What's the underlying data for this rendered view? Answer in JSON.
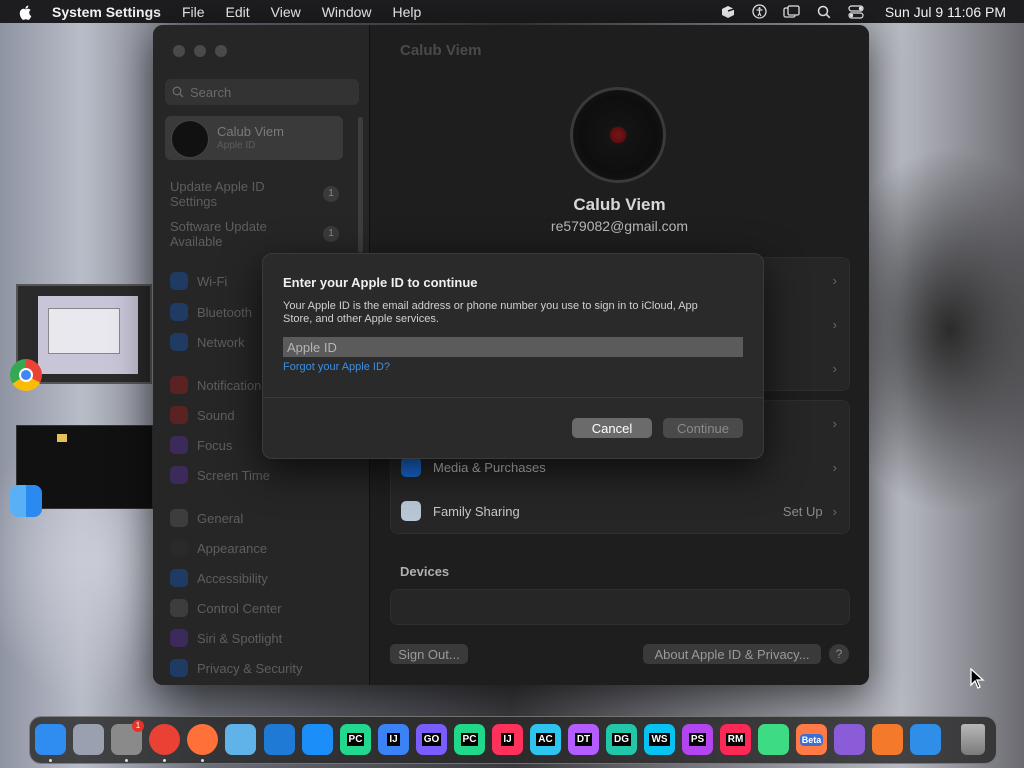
{
  "menubar": {
    "app_name": "System Settings",
    "items": [
      "File",
      "Edit",
      "View",
      "Window",
      "Help"
    ],
    "clock": "Sun Jul 9  11:06 PM"
  },
  "sidebar": {
    "search_placeholder": "Search",
    "account": {
      "name": "Calub Viem",
      "subtitle": "Apple ID"
    },
    "updates": [
      {
        "label": "Update Apple ID Settings",
        "badge": "1"
      },
      {
        "label": "Software Update Available",
        "badge": "1"
      }
    ],
    "items": [
      {
        "label": "Wi-Fi",
        "icon": "wifi-icon"
      },
      {
        "label": "Bluetooth",
        "icon": "bluetooth-icon"
      },
      {
        "label": "Network",
        "icon": "network-icon"
      },
      {
        "label": "Notifications",
        "icon": "notifications-icon"
      },
      {
        "label": "Sound",
        "icon": "sound-icon"
      },
      {
        "label": "Focus",
        "icon": "focus-icon"
      },
      {
        "label": "Screen Time",
        "icon": "screen-time-icon"
      },
      {
        "label": "General",
        "icon": "general-icon"
      },
      {
        "label": "Appearance",
        "icon": "appearance-icon"
      },
      {
        "label": "Accessibility",
        "icon": "accessibility-icon"
      },
      {
        "label": "Control Center",
        "icon": "control-center-icon"
      },
      {
        "label": "Siri & Spotlight",
        "icon": "siri-icon"
      },
      {
        "label": "Privacy & Security",
        "icon": "privacy-icon"
      }
    ]
  },
  "content": {
    "title": "Calub Viem",
    "user_name": "Calub Viem",
    "user_email": "re579082@gmail.com",
    "rows": [
      {
        "label": "Media & Purchases",
        "value": ""
      },
      {
        "label": "Family Sharing",
        "value": "Set Up"
      }
    ],
    "devices_heading": "Devices",
    "sign_out": "Sign Out...",
    "about": "About Apple ID & Privacy...",
    "help": "?"
  },
  "dialog": {
    "title": "Enter your Apple ID to continue",
    "description": "Your Apple ID is the email address or phone number you use to sign in to iCloud, App Store, and other Apple services.",
    "field_placeholder": "Apple ID",
    "field_value": "",
    "forgot": "Forgot your Apple ID?",
    "cancel": "Cancel",
    "continue": "Continue"
  },
  "dock": {
    "apps": [
      {
        "name": "finder-icon",
        "label": "",
        "color": "#2f8cf0"
      },
      {
        "name": "launchpad-icon",
        "label": "",
        "color": "#9aa0b0"
      },
      {
        "name": "system-settings-icon",
        "label": "",
        "color": "#8a8a8a"
      },
      {
        "name": "chrome-icon",
        "label": "",
        "color": "#e94235"
      },
      {
        "name": "firefox-icon",
        "label": "",
        "color": "#ff7139"
      },
      {
        "name": "preview-icon",
        "label": "",
        "color": "#5fb3e8"
      },
      {
        "name": "vscode-icon",
        "label": "",
        "color": "#1f7ad6"
      },
      {
        "name": "app-store-icon",
        "label": "",
        "color": "#1c8ef9"
      },
      {
        "name": "pycharm-ce-icon",
        "label": "PC",
        "color": "#22d88f"
      },
      {
        "name": "intellij-ce-icon",
        "label": "IJ",
        "color": "#3b82f6"
      },
      {
        "name": "goland-icon",
        "label": "GO",
        "color": "#7b5cff"
      },
      {
        "name": "pycharm-icon",
        "label": "PC",
        "color": "#21d789"
      },
      {
        "name": "intellij-icon",
        "label": "IJ",
        "color": "#fe315d"
      },
      {
        "name": "appcode-icon",
        "label": "AC",
        "color": "#2ec4f0"
      },
      {
        "name": "datagrip-icon",
        "label": "DT",
        "color": "#b35cff"
      },
      {
        "name": "datagrip2-icon",
        "label": "DG",
        "color": "#22c7a9"
      },
      {
        "name": "webstorm-icon",
        "label": "WS",
        "color": "#07c3f2"
      },
      {
        "name": "phpstorm-icon",
        "label": "PS",
        "color": "#b345f1"
      },
      {
        "name": "rubymine-icon",
        "label": "RM",
        "color": "#fe2857"
      },
      {
        "name": "android-studio-icon",
        "label": "",
        "color": "#3ddc84"
      },
      {
        "name": "xcode-beta-icon",
        "label": "Beta",
        "color": "#ff7a45"
      },
      {
        "name": "visual-studio-icon",
        "label": "",
        "color": "#8a5cd8"
      },
      {
        "name": "blender-icon",
        "label": "",
        "color": "#f5792a"
      },
      {
        "name": "simulator-icon",
        "label": "",
        "color": "#2f8fe8"
      },
      {
        "name": "trash-icon",
        "label": "",
        "color": "#9a9a9a"
      }
    ],
    "settings_badge": "1"
  }
}
